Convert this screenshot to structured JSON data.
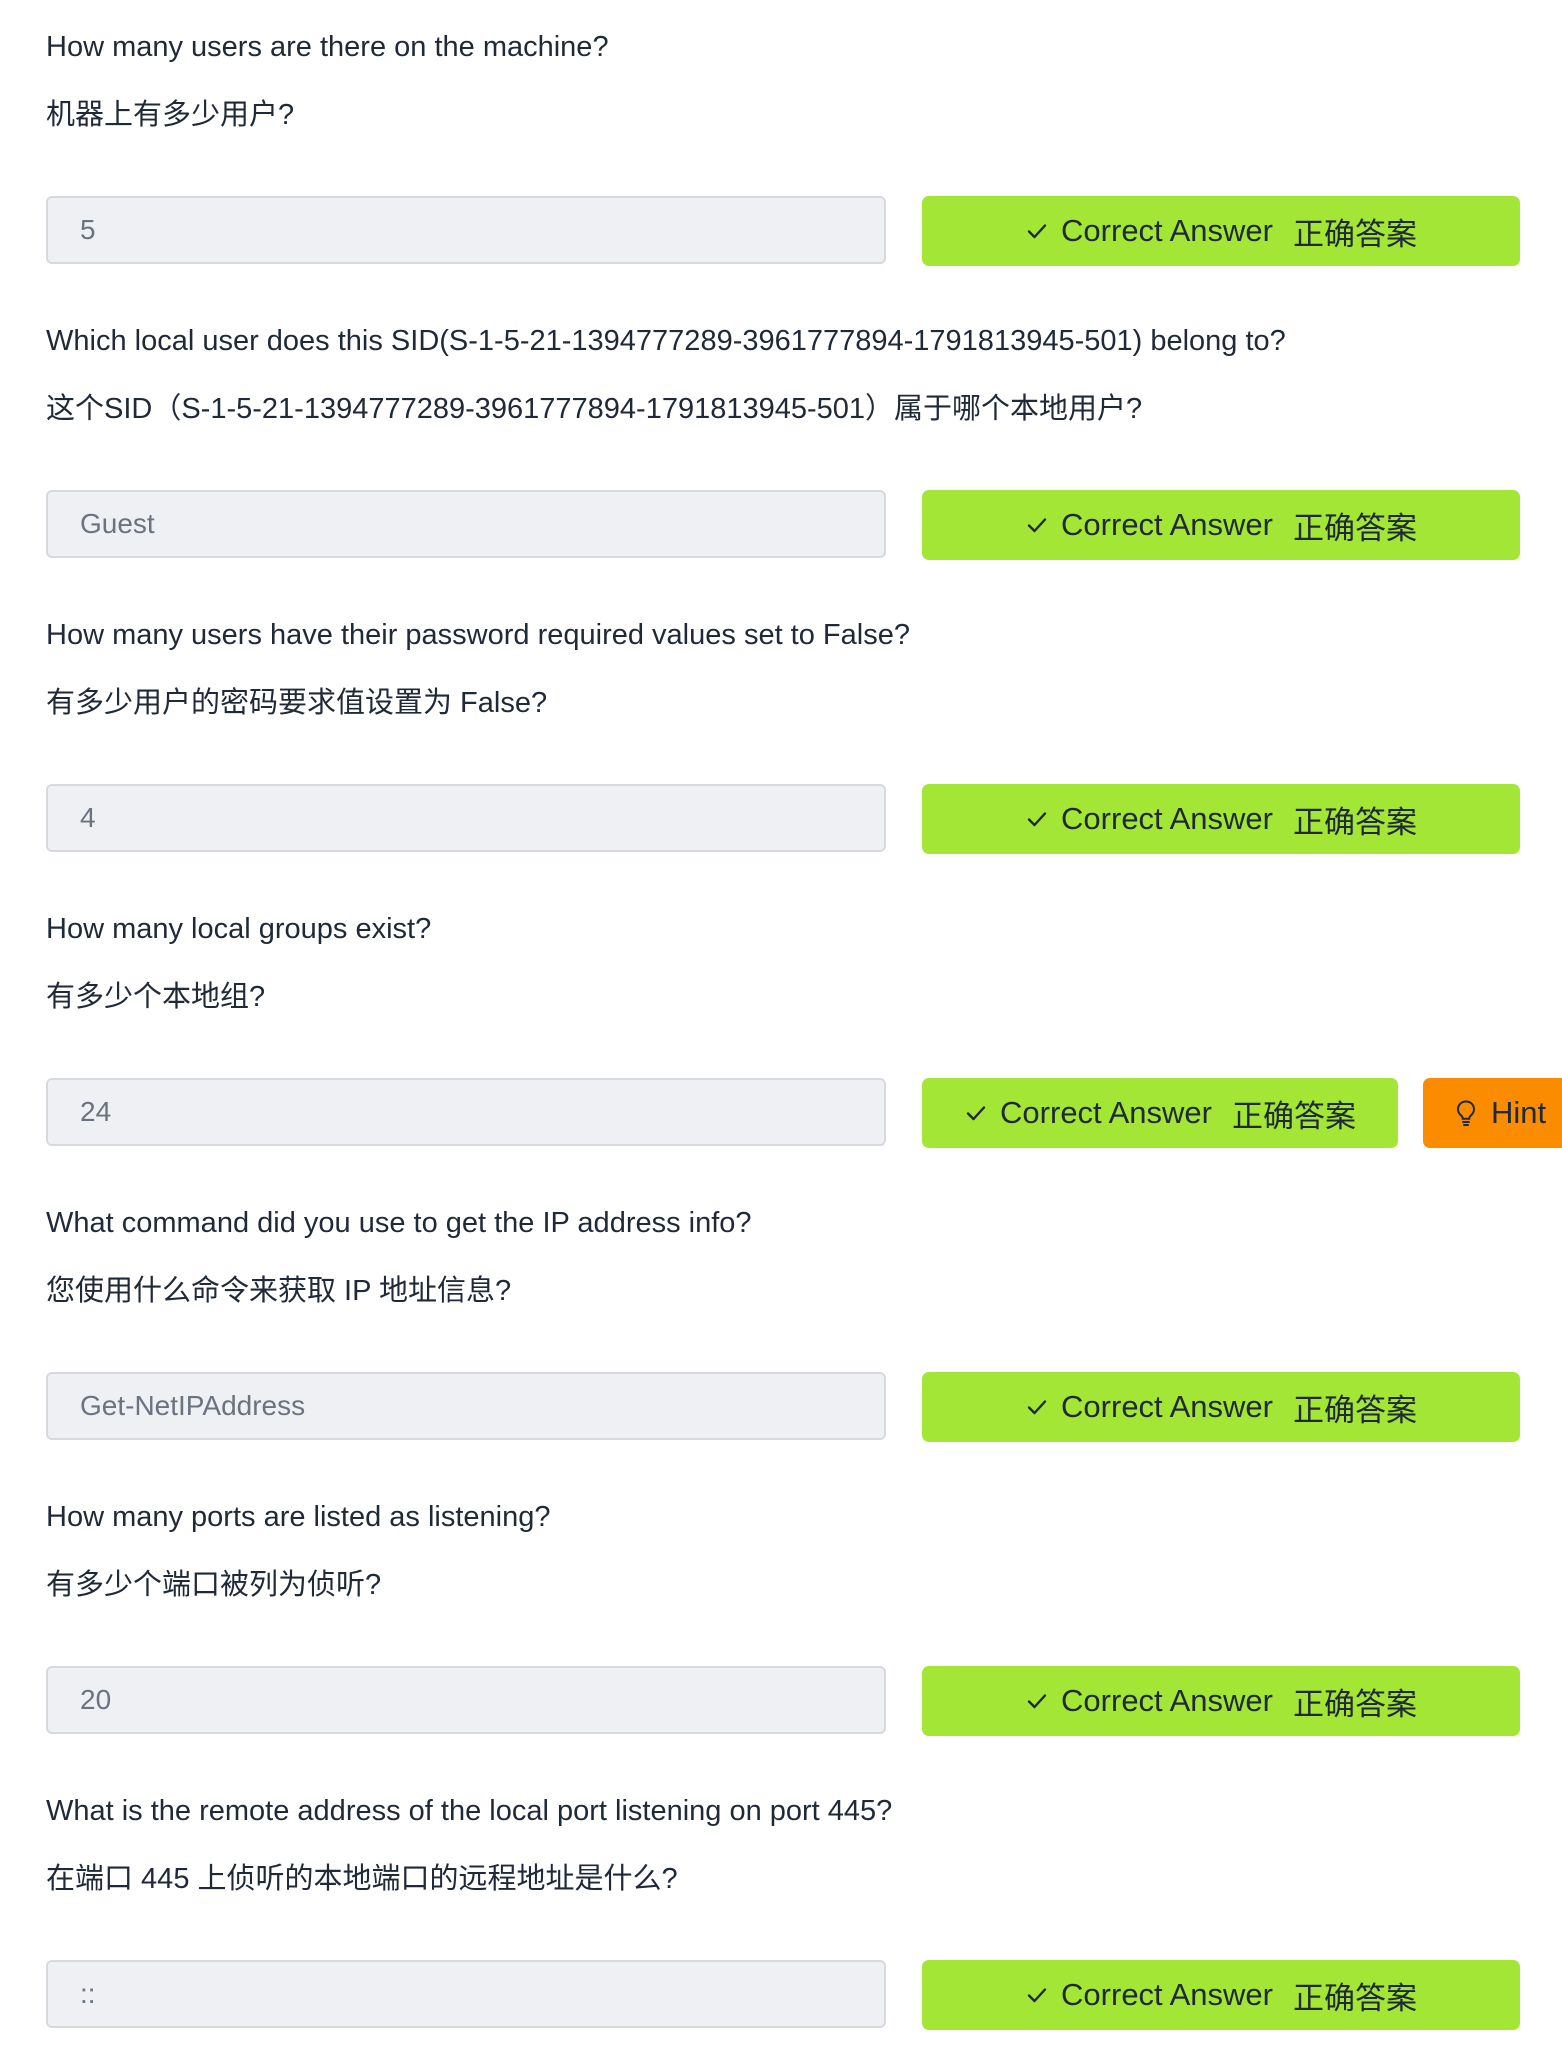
{
  "colors": {
    "correct_bg": "#a3e635",
    "hint_bg": "#fb8c00",
    "field_bg": "#eef0f3",
    "field_border": "#d6d9de"
  },
  "questions": [
    {
      "en": "How many users are there on the machine?",
      "zh": "机器上有多少用户?",
      "answer": "5",
      "correct_label": "Correct Answer",
      "correct_label_zh": "正确答案"
    },
    {
      "en": "Which local user does this SID(S-1-5-21-1394777289-3961777894-1791813945-501) belong to?",
      "zh": "这个SID（S-1-5-21-1394777289-3961777894-1791813945-501）属于哪个本地用户?",
      "answer": "Guest",
      "correct_label": "Correct Answer",
      "correct_label_zh": "正确答案"
    },
    {
      "en": "How many users have their password required values set to False?",
      "zh": "有多少用户的密码要求值设置为 False?",
      "answer": "4",
      "correct_label": "Correct Answer",
      "correct_label_zh": "正确答案"
    },
    {
      "en": "How many local groups exist?",
      "zh": "有多少个本地组?",
      "answer": "24",
      "correct_label": "Correct Answer",
      "correct_label_zh": "正确答案",
      "hint_label": "Hint"
    },
    {
      "en": "What command did you use to get the IP address info?",
      "zh": "您使用什么命令来获取 IP 地址信息?",
      "answer": "Get-NetIPAddress",
      "correct_label": "Correct Answer",
      "correct_label_zh": "正确答案"
    },
    {
      "en": "How many ports are listed as listening?",
      "zh": "有多少个端口被列为侦听?",
      "answer": "20",
      "correct_label": "Correct Answer",
      "correct_label_zh": "正确答案"
    },
    {
      "en": "What is the remote address of the local port listening on port 445?",
      "zh": "在端口 445 上侦听的本地端口的远程地址是什么?",
      "answer": "::",
      "correct_label": "Correct Answer",
      "correct_label_zh": "正确答案"
    }
  ]
}
